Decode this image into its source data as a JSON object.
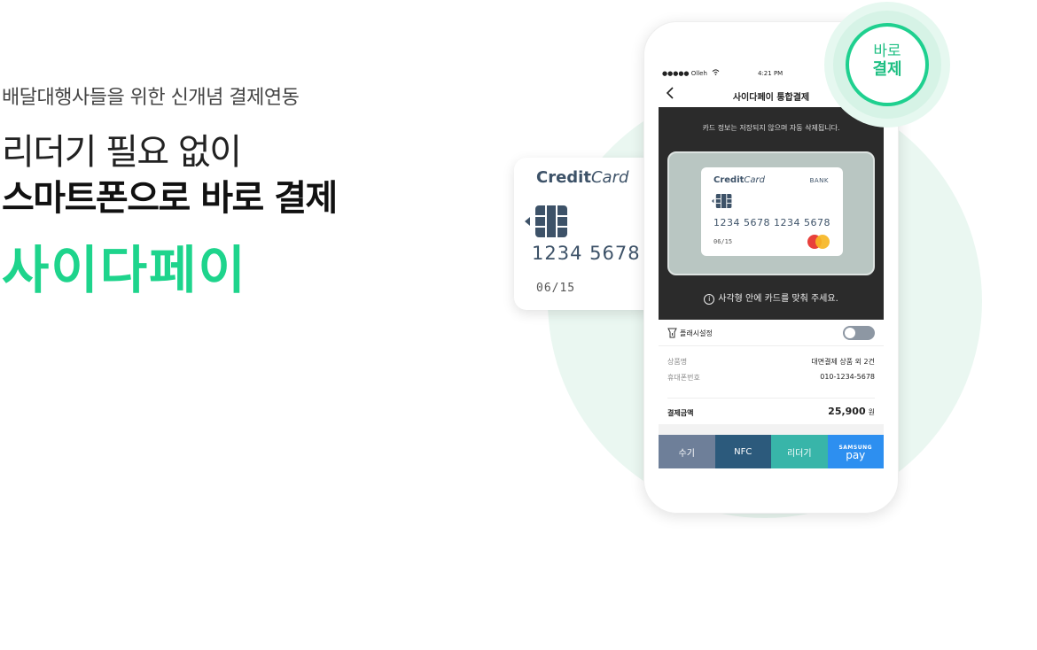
{
  "hero": {
    "subtitle": "배달대행사들을 위한 신개념 결제연동",
    "headline_1": "리더기 필요 없이",
    "headline_2": "스마트폰으로 바로 결제",
    "brand": "사이다페이"
  },
  "float_card": {
    "brand_bold": "Credit",
    "brand_italic": "Card",
    "number": "1234  5678",
    "expiry": "06/15"
  },
  "badge": {
    "line1": "바로",
    "line2": "결제"
  },
  "phone": {
    "status": {
      "carrier": "●●●●● Olleh",
      "time": "4:21 PM"
    },
    "nav": {
      "title": "사이다페이 통합결제"
    },
    "scan": {
      "notice": "카드 정보는 저장되지 않으며 자동 삭제됩니다.",
      "card": {
        "brand_bold": "Credit",
        "brand_italic": "Card",
        "bank": "BANK",
        "number": "1234  5678  1234  5678",
        "expiry": "06/15"
      },
      "hint": "사각형 안에 카드를 맞춰 주세요."
    },
    "flash": {
      "label": "플래시설정",
      "enabled": false
    },
    "info": [
      {
        "key": "상품명",
        "value": "대면결제 상품 외 2건"
      },
      {
        "key": "휴대폰번호",
        "value": "010-1234-5678"
      }
    ],
    "total": {
      "key": "결제금액",
      "value": "25,900",
      "unit": "원"
    },
    "tabs": {
      "manual": "수기",
      "nfc": "NFC",
      "reader": "리더기",
      "samsung_top": "SAMSUNG",
      "samsung_bottom": "pay"
    }
  },
  "colors": {
    "brand_green": "#1ed48c",
    "card_text": "#3d5268",
    "tab_manual": "#6e7f99",
    "tab_nfc": "#2c5a7c",
    "tab_reader": "#38b5a9",
    "tab_samsung": "#2d8ff0"
  }
}
